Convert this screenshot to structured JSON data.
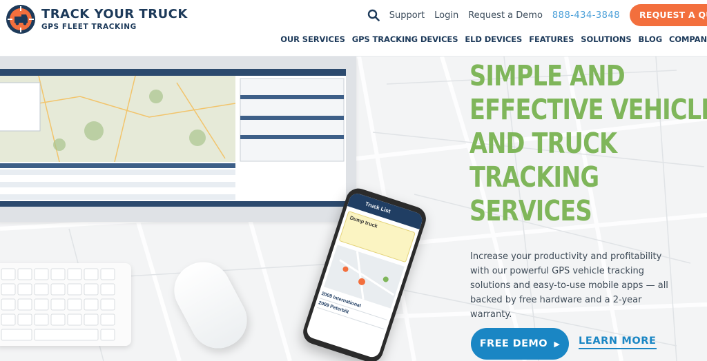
{
  "brand": {
    "name": "TRACK YOUR TRUCK",
    "tagline": "GPS FLEET TRACKING"
  },
  "topbar": {
    "links": [
      "Support",
      "Login",
      "Request a Demo"
    ],
    "phone": "888-434-3848",
    "cta_label": "REQUEST A QUOTE"
  },
  "nav": {
    "items": [
      "OUR SERVICES",
      "GPS TRACKING DEVICES",
      "ELD DEVICES",
      "FEATURES",
      "SOLUTIONS",
      "BLOG",
      "COMPAN"
    ]
  },
  "hero": {
    "headline": [
      "SIMPLE AND",
      "EFFECTIVE VEHICLE",
      "AND TRUCK",
      "TRACKING",
      "SERVICES"
    ],
    "lead": "Increase your productivity and profitability with our powerful GPS vehicle tracking solutions and easy-to-use mobile apps — all backed by free hardware and a 2-year warranty.",
    "primary_cta": "FREE DEMO",
    "secondary_cta": "LEARN MORE"
  },
  "phone_app": {
    "header": "Truck List",
    "card_title": "Dump truck",
    "list": [
      "2009 International",
      "2009 Peterbilt"
    ]
  },
  "colors": {
    "navy": "#1d3a5a",
    "green": "#7fb65a",
    "orange": "#f36f3d",
    "blue": "#1a86c4",
    "phone_blue": "#4a9fd8"
  }
}
